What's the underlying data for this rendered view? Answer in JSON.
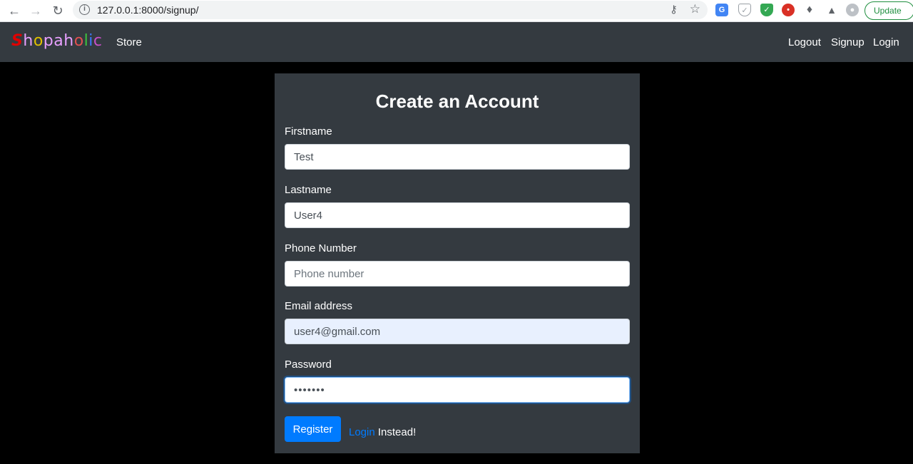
{
  "browser": {
    "url": "127.0.0.1:8000/signup/",
    "update_label": "Update"
  },
  "navbar": {
    "brand_letters": [
      {
        "ch": "S",
        "color": "#e00000"
      },
      {
        "ch": "h",
        "color": "#e8a0ff"
      },
      {
        "ch": "o",
        "color": "#e0c000"
      },
      {
        "ch": "p",
        "color": "#e8a0ff"
      },
      {
        "ch": "a",
        "color": "#e8a0ff"
      },
      {
        "ch": "h",
        "color": "#e8a0ff"
      },
      {
        "ch": "o",
        "color": "#e05050"
      },
      {
        "ch": "l",
        "color": "#3ec43e"
      },
      {
        "ch": "i",
        "color": "#3c7bff"
      },
      {
        "ch": "c",
        "color": "#c850c8"
      }
    ],
    "store_label": "Store",
    "logout_label": "Logout",
    "signup_label": "Signup",
    "login_label": "Login"
  },
  "form": {
    "title": "Create an Account",
    "firstname": {
      "label": "Firstname",
      "value": "Test",
      "placeholder": ""
    },
    "lastname": {
      "label": "Lastname",
      "value": "User4",
      "placeholder": ""
    },
    "phone": {
      "label": "Phone Number",
      "value": "",
      "placeholder": "Phone number"
    },
    "email": {
      "label": "Email address",
      "value": "user4@gmail.com",
      "placeholder": ""
    },
    "password": {
      "label": "Password",
      "value": "•••••••",
      "placeholder": ""
    },
    "register_label": "Register",
    "login_link": "Login",
    "login_suffix": "Instead!"
  }
}
